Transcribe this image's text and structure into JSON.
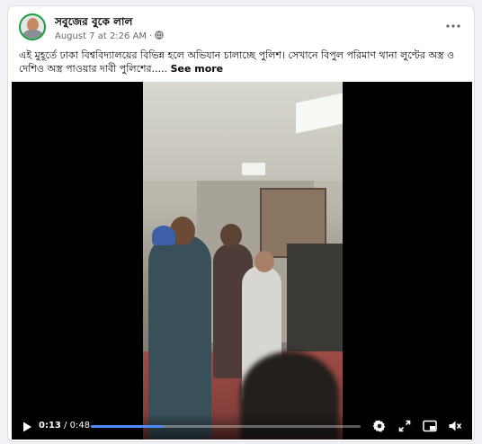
{
  "post": {
    "author": "সবুজের বুকে লাল",
    "date": "August 7 at 2:26 AM",
    "separator": "·",
    "privacy_icon": "globe-icon",
    "more_icon": "more-options-icon",
    "caption": "এই মুহূর্তে ঢাকা বিশ্ববিদ্যালয়ের বিভিন্ন হলে অভিযান চালাচ্ছে পুলিশ। সেখানে বিপুল পরিমাণ থানা লুণ্টের অস্ত্র ও দেশিও অস্ত্র পাওয়ার দাবী পুলিশের..... ",
    "see_more": "See more"
  },
  "video": {
    "current_time": "0:13",
    "time_separator": " / ",
    "duration": "0:48",
    "progress": 0.27,
    "icons": [
      "play-icon",
      "settings-gear-icon",
      "fullscreen-icon",
      "picture-in-picture-icon",
      "volume-icon"
    ]
  },
  "colors": {
    "accent": "#4d8bf5",
    "avatar_ring": "#1b9e3a",
    "text_primary": "#050505",
    "text_secondary": "#65676b"
  }
}
